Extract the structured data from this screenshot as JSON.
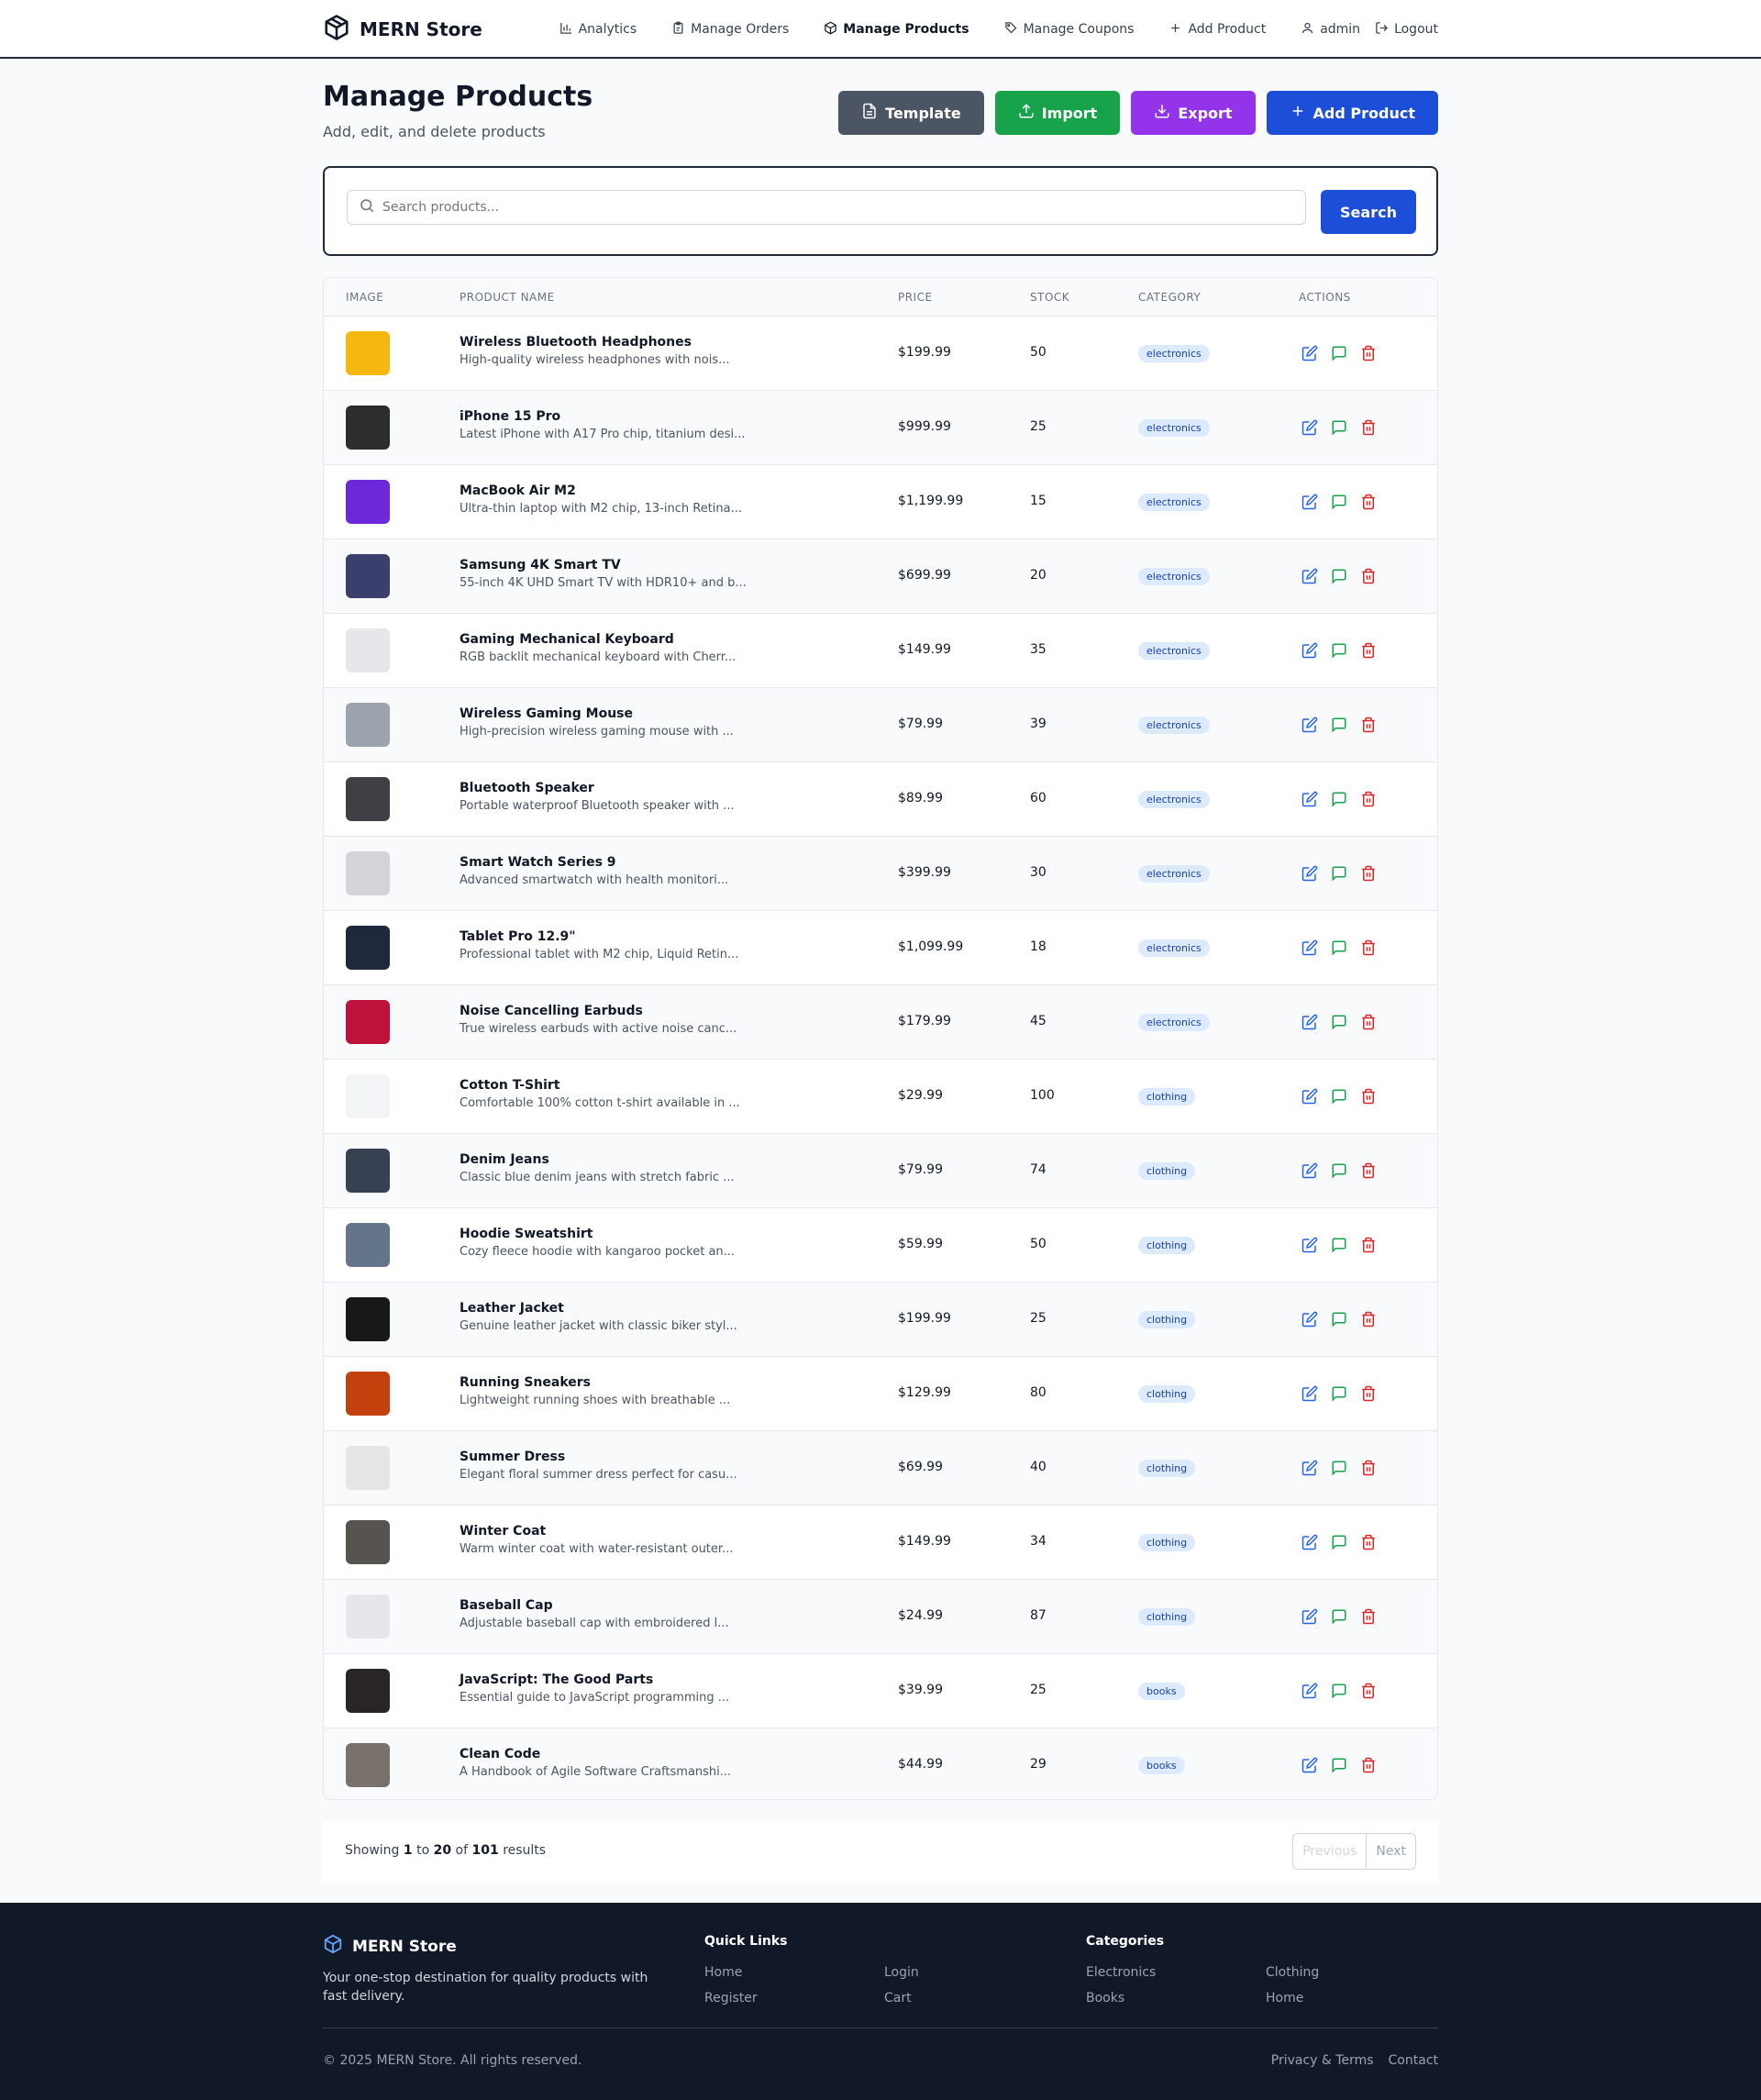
{
  "header": {
    "brand": "MERN Store",
    "nav": [
      {
        "label": "Analytics",
        "icon": "bar-chart-icon"
      },
      {
        "label": "Manage Orders",
        "icon": "clipboard-icon"
      },
      {
        "label": "Manage Products",
        "icon": "package-icon"
      },
      {
        "label": "Manage Coupons",
        "icon": "tag-icon"
      },
      {
        "label": "Add Product",
        "icon": "plus-icon"
      }
    ],
    "user": "admin",
    "logout": "Logout"
  },
  "page": {
    "title": "Manage Products",
    "subtitle": "Add, edit, and delete products",
    "buttons": {
      "template": "Template",
      "import": "Import",
      "export": "Export",
      "add": "Add Product"
    }
  },
  "search": {
    "placeholder": "Search products...",
    "button": "Search"
  },
  "table": {
    "headers": {
      "image": "IMAGE",
      "name": "PRODUCT NAME",
      "price": "PRICE",
      "stock": "STOCK",
      "category": "CATEGORY",
      "actions": "ACTIONS"
    },
    "rows": [
      {
        "name": "Wireless Bluetooth Headphones",
        "desc": "High-quality wireless headphones with nois...",
        "price": "$199.99",
        "stock": "50",
        "category": "electronics",
        "thumb": "#f5b80e"
      },
      {
        "name": "iPhone 15 Pro",
        "desc": "Latest iPhone with A17 Pro chip, titanium desi...",
        "price": "$999.99",
        "stock": "25",
        "category": "electronics",
        "thumb": "#2d2d2f"
      },
      {
        "name": "MacBook Air M2",
        "desc": "Ultra-thin laptop with M2 chip, 13-inch Retina...",
        "price": "$1,199.99",
        "stock": "15",
        "category": "electronics",
        "thumb": "#6d28d9"
      },
      {
        "name": "Samsung 4K Smart TV",
        "desc": "55-inch 4K UHD Smart TV with HDR10+ and b...",
        "price": "$699.99",
        "stock": "20",
        "category": "electronics",
        "thumb": "#3b3f6e"
      },
      {
        "name": "Gaming Mechanical Keyboard",
        "desc": "RGB backlit mechanical keyboard with Cherr...",
        "price": "$149.99",
        "stock": "35",
        "category": "electronics",
        "thumb": "#e5e7eb"
      },
      {
        "name": "Wireless Gaming Mouse",
        "desc": "High-precision wireless gaming mouse with ...",
        "price": "$79.99",
        "stock": "39",
        "category": "electronics",
        "thumb": "#9ca3af"
      },
      {
        "name": "Bluetooth Speaker",
        "desc": "Portable waterproof Bluetooth speaker with ...",
        "price": "$89.99",
        "stock": "60",
        "category": "electronics",
        "thumb": "#3f3f46"
      },
      {
        "name": "Smart Watch Series 9",
        "desc": "Advanced smartwatch with health monitori...",
        "price": "$399.99",
        "stock": "30",
        "category": "electronics",
        "thumb": "#d4d4d8"
      },
      {
        "name": "Tablet Pro 12.9\"",
        "desc": "Professional tablet with M2 chip, Liquid Retin...",
        "price": "$1,099.99",
        "stock": "18",
        "category": "electronics",
        "thumb": "#1e293b"
      },
      {
        "name": "Noise Cancelling Earbuds",
        "desc": "True wireless earbuds with active noise canc...",
        "price": "$179.99",
        "stock": "45",
        "category": "electronics",
        "thumb": "#be123c"
      },
      {
        "name": "Cotton T-Shirt",
        "desc": "Comfortable 100% cotton t-shirt available in ...",
        "price": "$29.99",
        "stock": "100",
        "category": "clothing",
        "thumb": "#f3f4f6"
      },
      {
        "name": "Denim Jeans",
        "desc": "Classic blue denim jeans with stretch fabric ...",
        "price": "$79.99",
        "stock": "74",
        "category": "clothing",
        "thumb": "#374151"
      },
      {
        "name": "Hoodie Sweatshirt",
        "desc": "Cozy fleece hoodie with kangaroo pocket an...",
        "price": "$59.99",
        "stock": "50",
        "category": "clothing",
        "thumb": "#64748b"
      },
      {
        "name": "Leather Jacket",
        "desc": "Genuine leather jacket with classic biker styl...",
        "price": "$199.99",
        "stock": "25",
        "category": "clothing",
        "thumb": "#18181b"
      },
      {
        "name": "Running Sneakers",
        "desc": "Lightweight running shoes with breathable ...",
        "price": "$129.99",
        "stock": "80",
        "category": "clothing",
        "thumb": "#c2410c"
      },
      {
        "name": "Summer Dress",
        "desc": "Elegant floral summer dress perfect for casu...",
        "price": "$69.99",
        "stock": "40",
        "category": "clothing",
        "thumb": "#e7e5e4"
      },
      {
        "name": "Winter Coat",
        "desc": "Warm winter coat with water-resistant outer...",
        "price": "$149.99",
        "stock": "34",
        "category": "clothing",
        "thumb": "#57534e"
      },
      {
        "name": "Baseball Cap",
        "desc": "Adjustable baseball cap with embroidered l...",
        "price": "$24.99",
        "stock": "87",
        "category": "clothing",
        "thumb": "#e5e7eb"
      },
      {
        "name": "JavaScript: The Good Parts",
        "desc": "Essential guide to JavaScript programming ...",
        "price": "$39.99",
        "stock": "25",
        "category": "books",
        "thumb": "#292524"
      },
      {
        "name": "Clean Code",
        "desc": "A Handbook of Agile Software Craftsmanshi...",
        "price": "$44.99",
        "stock": "29",
        "category": "books",
        "thumb": "#78716c"
      }
    ]
  },
  "pagination": {
    "showing": "Showing",
    "from": "1",
    "to_word": "to",
    "to": "20",
    "of_word": "of",
    "total": "101",
    "results": "results",
    "previous": "Previous",
    "next": "Next"
  },
  "footer": {
    "brand": "MERN Store",
    "tagline": "Your one-stop destination for quality products with fast delivery.",
    "quick_links_title": "Quick Links",
    "quick_links": [
      "Home",
      "Login",
      "Register",
      "Cart"
    ],
    "categories_title": "Categories",
    "categories": [
      "Electronics",
      "Clothing",
      "Books",
      "Home"
    ],
    "copyright": "© 2025 MERN Store. All rights reserved.",
    "privacy": "Privacy & Terms",
    "contact": "Contact"
  },
  "colors": {
    "primary": "#1d4ed8",
    "edit": "#2563eb",
    "review": "#16a34a",
    "delete": "#dc2626",
    "template": "#4b5563",
    "import": "#16a34a",
    "export": "#9333ea"
  }
}
